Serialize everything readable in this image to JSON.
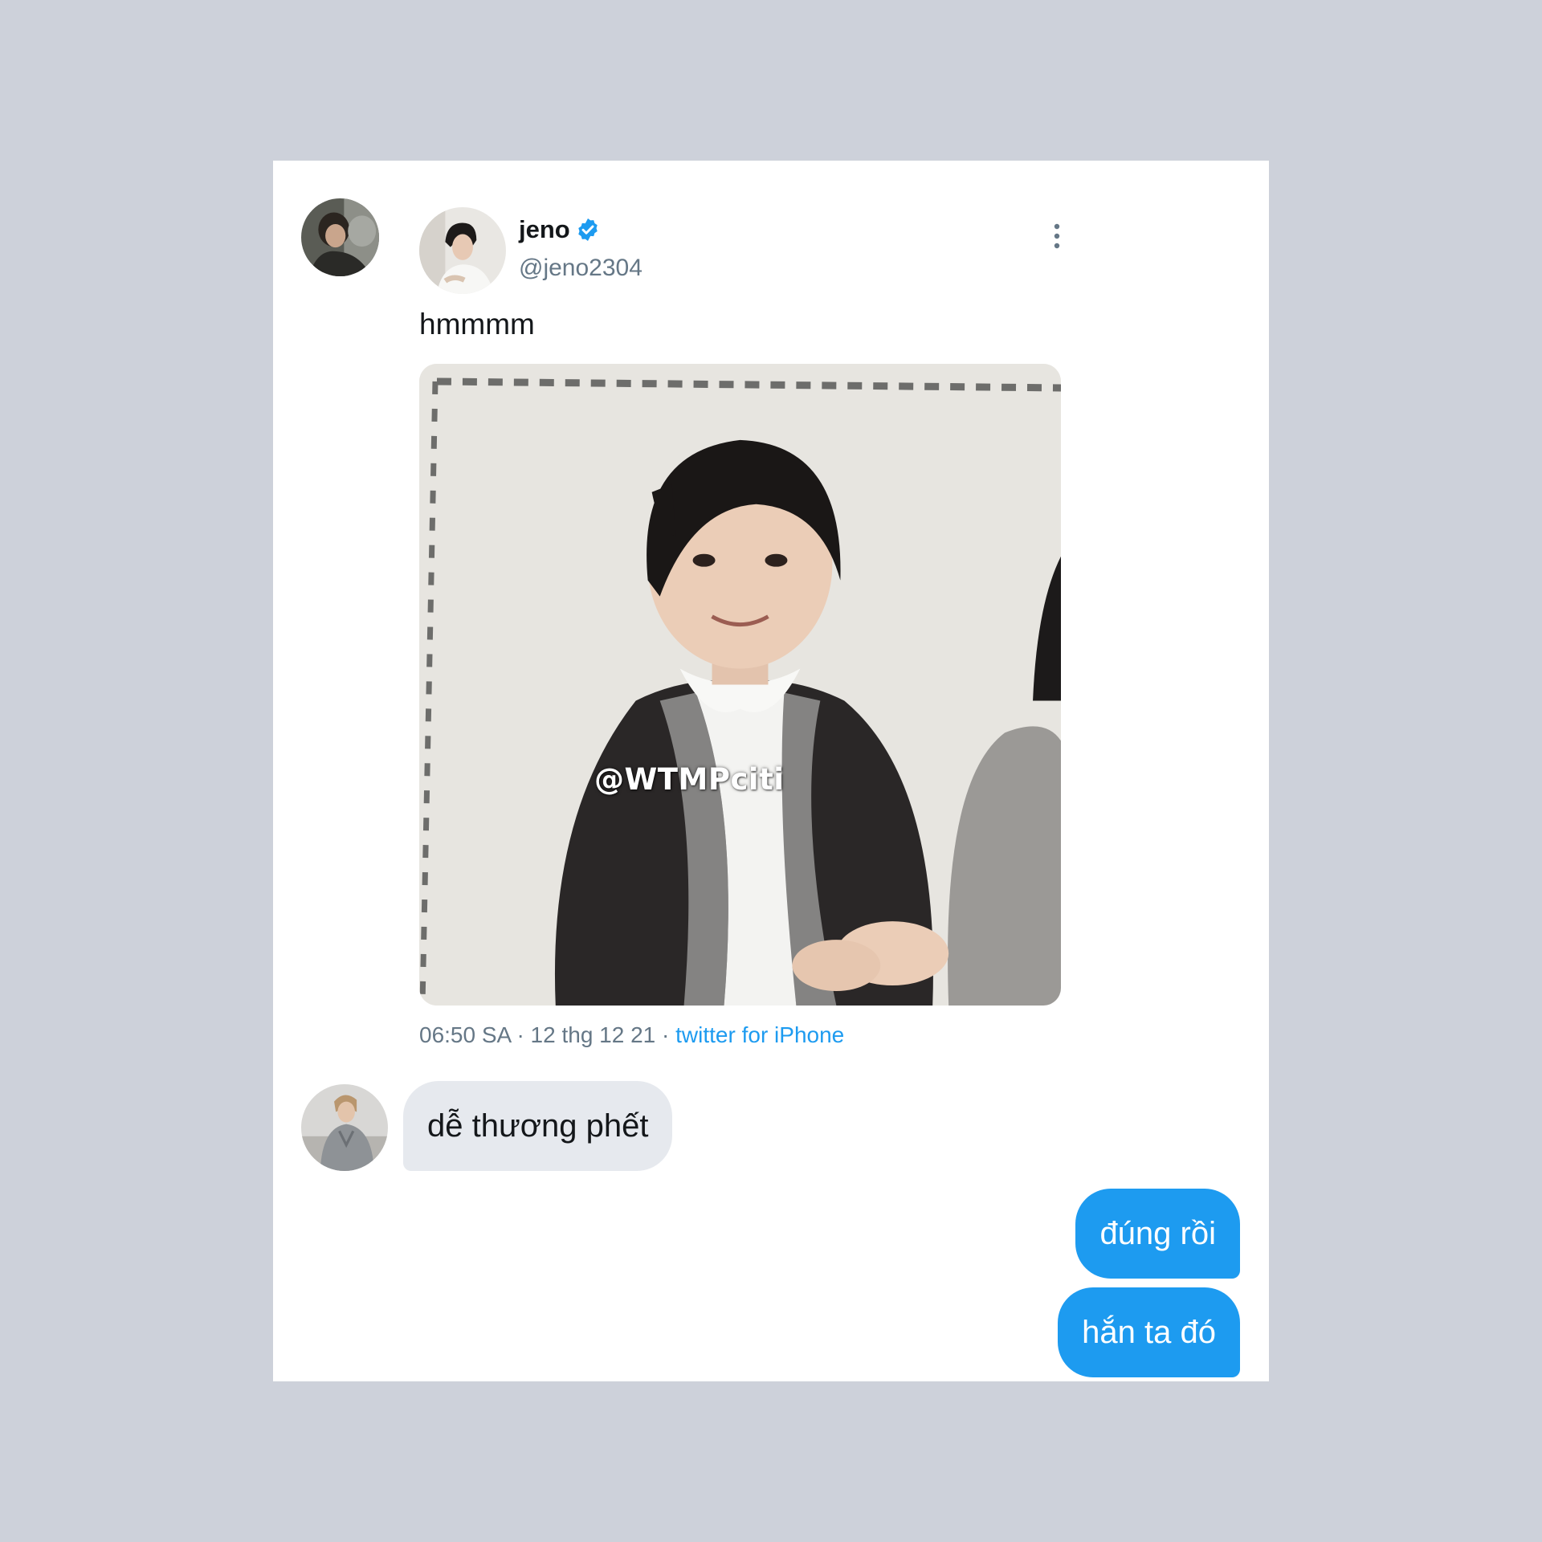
{
  "tweet": {
    "author_name": "jeno",
    "author_handle": "@jeno2304",
    "verified": true,
    "text": "hmmmm",
    "image_watermark": "@WTMPciti",
    "time": "06:50 SA",
    "date": "12 thg 12 21",
    "source": "twitter for iPhone",
    "separator": "·",
    "more_icon": "more-vertical-icon",
    "verified_icon": "verified-badge-icon"
  },
  "messages": [
    {
      "direction": "incoming",
      "text": "dễ thương phết"
    },
    {
      "direction": "outgoing",
      "text": "đúng rồi"
    },
    {
      "direction": "outgoing",
      "text": "hắn ta đó"
    }
  ],
  "colors": {
    "page_background": "#cdd1da",
    "accent": "#1d9bf0",
    "incoming_bubble": "#e6e9ee",
    "text_primary": "#14171a",
    "text_secondary": "#657786"
  }
}
